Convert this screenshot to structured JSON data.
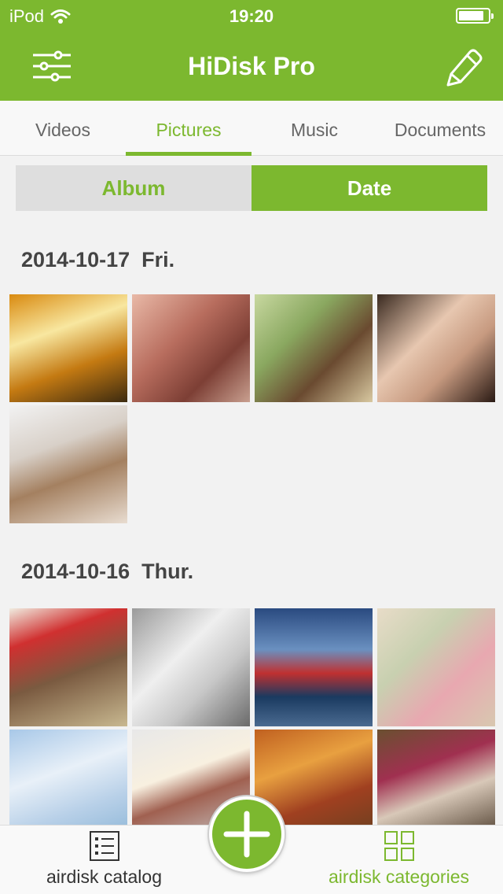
{
  "status": {
    "carrier": "iPod",
    "time": "19:20",
    "battery_level": 0.85
  },
  "header": {
    "title": "HiDisk Pro",
    "left_icon": "settings-sliders-icon",
    "right_icon": "pencil-edit-icon"
  },
  "tabs": [
    {
      "label": "Videos",
      "active": false
    },
    {
      "label": "Pictures",
      "active": true
    },
    {
      "label": "Music",
      "active": false
    },
    {
      "label": "Documents",
      "active": false
    }
  ],
  "segment": {
    "album": "Album",
    "date": "Date",
    "selected": "Date"
  },
  "groups": [
    {
      "date": "2014-10-17  Fri.",
      "photos": [
        {
          "bg": "linear-gradient(160deg,#d98a10 0%,#f8e7a0 35%,#c47a12 65%,#3c2a10 100%)"
        },
        {
          "bg": "linear-gradient(135deg,#e9b9a7 0%,#b86d5e 40%,#7d3f35 70%,#c9a090 100%)"
        },
        {
          "bg": "linear-gradient(135deg,#c8d8a0 0%,#8aa860 35%,#6a4a30 65%,#d8c8a0 100%)"
        },
        {
          "bg": "linear-gradient(135deg,#3a2a20 0%,#e7c7b0 40%,#c79a80 65%,#2a1a14 100%)"
        },
        {
          "bg": "linear-gradient(160deg,#f2f2f2 0%,#d8d0c8 35%,#a48060 60%,#e8dcd0 100%)"
        }
      ]
    },
    {
      "date": "2014-10-16  Thur.",
      "photos": [
        {
          "bg": "linear-gradient(160deg,#f0ece0 0%,#d03030 25%,#7a5a40 55%,#c8b890 100%)"
        },
        {
          "bg": "linear-gradient(135deg,#9a9a9a 0%,#efefef 40%,#c8c8c8 65%,#6a6a6a 100%)"
        },
        {
          "bg": "linear-gradient(180deg,#2a4a80 0%,#6a90c0 35%,#c03030 55%,#1a3a60 75%,#4a6a90 100%)"
        },
        {
          "bg": "linear-gradient(135deg,#e8dcc8 0%,#c8d0b0 35%,#e8a8b0 65%,#d8c8b0 100%)"
        },
        {
          "bg": "linear-gradient(160deg,#a8c8e8 0%,#e8f0f8 40%,#b8d0e8 70%,#90b8d8 100%)"
        },
        {
          "bg": "linear-gradient(160deg,#e8e8e8 0%,#f8f0e0 40%,#a06050 60%,#c8c8c8 100%)"
        },
        {
          "bg": "linear-gradient(160deg,#c06020 0%,#e8a040 35%,#a04020 65%,#6a4020 100%)"
        },
        {
          "bg": "linear-gradient(160deg,#6a5030 0%,#a03050 35%,#d8c8b8 60%,#504030 100%)"
        }
      ]
    }
  ],
  "bottom": {
    "left_label": "airdisk catalog",
    "right_label": "airdisk categories",
    "center_icon": "add-plus-icon"
  },
  "colors": {
    "accent": "#7cb82f",
    "background": "#f2f2f2"
  }
}
